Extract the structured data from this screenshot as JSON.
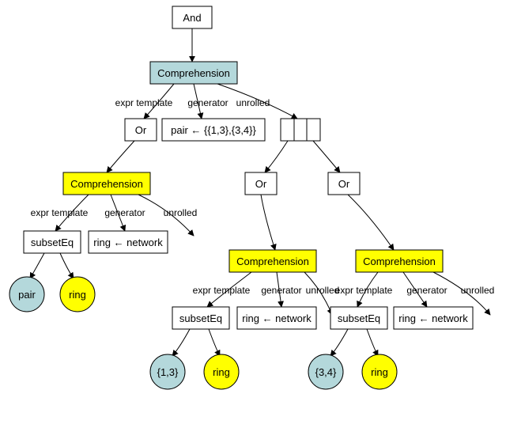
{
  "nodes": {
    "and": "And",
    "comp1": "Comprehension",
    "or1": "Or",
    "gen1": "pair ← {{1,3},{3,4}}",
    "comp2": "Comprehension",
    "subset1": "subsetEq",
    "gen2": "ring ← network",
    "pair": "pair",
    "ring1": "ring",
    "or2": "Or",
    "or3": "Or",
    "comp3": "Comprehension",
    "comp4": "Comprehension",
    "subset3": "subsetEq",
    "gen3": "ring ← network",
    "subset4": "subsetEq",
    "gen4": "ring ← network",
    "set13": "{1,3}",
    "ring3": "ring",
    "set34": "{3,4}",
    "ring4": "ring"
  },
  "edge_labels": {
    "expr_tmpl": "expr template",
    "generator": "generator",
    "unrolled": "unrolled"
  },
  "colors": {
    "blue": "#b4d8db",
    "yellow": "#ffff00"
  }
}
